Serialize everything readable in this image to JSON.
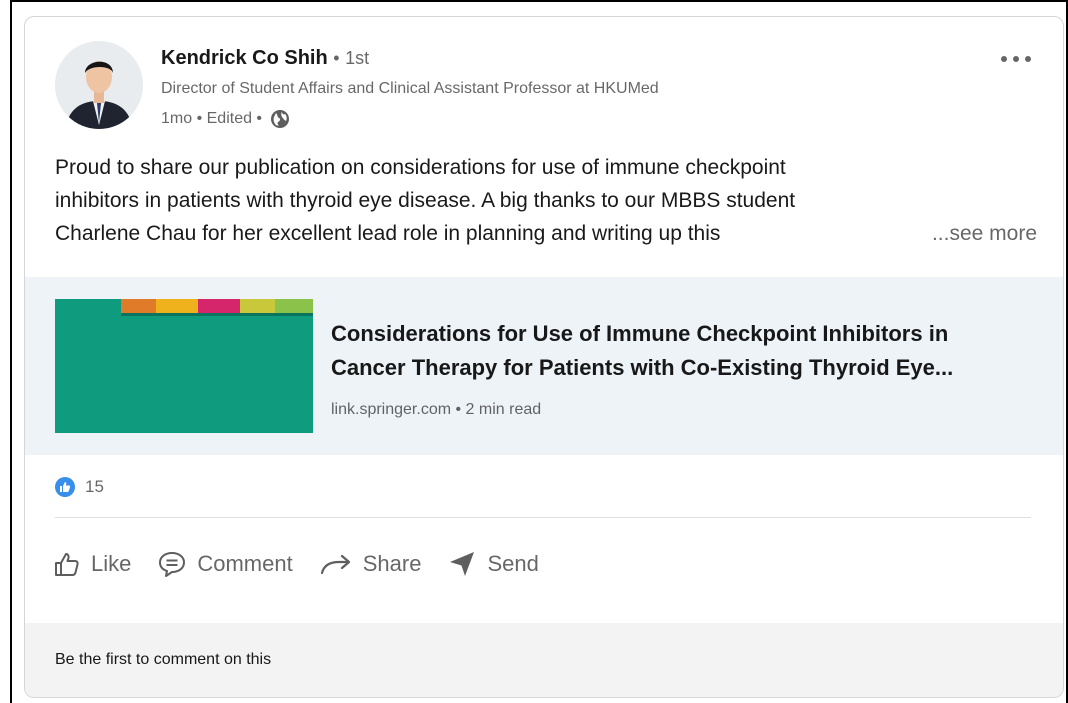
{
  "author": {
    "name": "Kendrick Co Shih",
    "separator": "•",
    "degree": "1st",
    "headline": "Director of Student Affairs and Clinical Assistant Professor at HKUMed",
    "meta": "1mo • Edited •"
  },
  "post": {
    "lines": [
      "Proud to share our publication on considerations for use of immune checkpoint",
      "inhibitors in patients with thyroid eye disease. A big thanks to our MBBS student",
      "Charlene Chau for her excellent lead role in planning and writing up this"
    ],
    "see_more": "...see more"
  },
  "article": {
    "title_lines": [
      "Considerations for Use of Immune Checkpoint Inhibitors in",
      "Cancer Therapy for Patients with Co-Existing Thyroid Eye..."
    ],
    "source": "link.springer.com • 2 min read",
    "thumbnail_colors": {
      "background": "#0f9b7e",
      "bar": [
        "#e07b2a",
        "#f0b21c",
        "#d6266b",
        "#c8c83a",
        "#8bc34a"
      ]
    }
  },
  "reactions": {
    "count": "15",
    "icon": "like-reaction-icon",
    "color": "#378fe9"
  },
  "actions": {
    "like": "Like",
    "comment": "Comment",
    "share": "Share",
    "send": "Send"
  },
  "footer": {
    "text": "Be the first to comment on this"
  }
}
